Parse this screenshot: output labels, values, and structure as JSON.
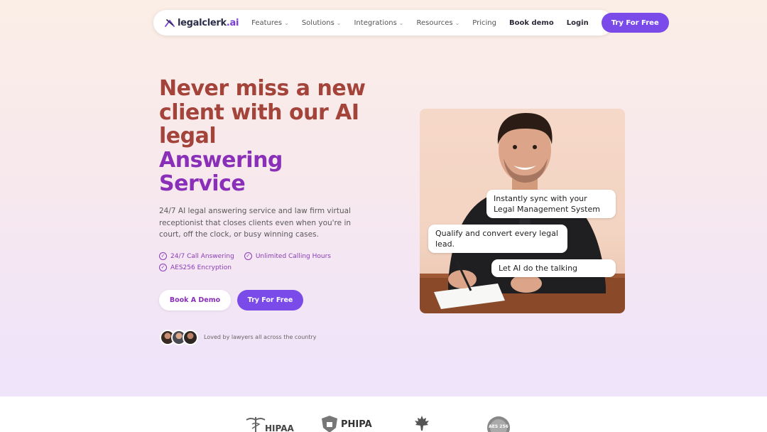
{
  "nav": {
    "logo_text": "legalclerk",
    "logo_suffix": ".ai",
    "items": [
      {
        "label": "Features"
      },
      {
        "label": "Solutions"
      },
      {
        "label": "Integrations"
      },
      {
        "label": "Resources"
      }
    ],
    "pricing": "Pricing",
    "book_demo": "Book demo",
    "login": "Login",
    "cta": "Try For Free"
  },
  "hero": {
    "headline_line1": "Never miss a new",
    "headline_line2": "client with our AI",
    "headline_line3": "legal",
    "headline_accent1": "Answering",
    "headline_accent2": "Service",
    "subtext": "24/7 AI legal answering service and law firm virtual receptionist that closes clients even when you're in court, off the clock, or busy winning cases.",
    "features": [
      {
        "label": "24/7 Call Answering"
      },
      {
        "label": "Unlimited Calling Hours"
      },
      {
        "label": "AES256 Encryption"
      }
    ],
    "btn_demo": "Book A Demo",
    "btn_try": "Try For Free",
    "loved": "Loved by lawyers all across the country"
  },
  "card": {
    "bubble1": "Instantly sync with your Legal Management System",
    "bubble2": "Qualify and convert every legal lead.",
    "bubble3": "Let AI do the talking"
  },
  "badges": {
    "hipaa": "HIPAA",
    "phipa": "PHIPA",
    "aes": "AES 256"
  },
  "colors": {
    "brand": "#7a4be8",
    "headline_red": "#a3433a",
    "headline_purple": "#8a2fb8"
  }
}
